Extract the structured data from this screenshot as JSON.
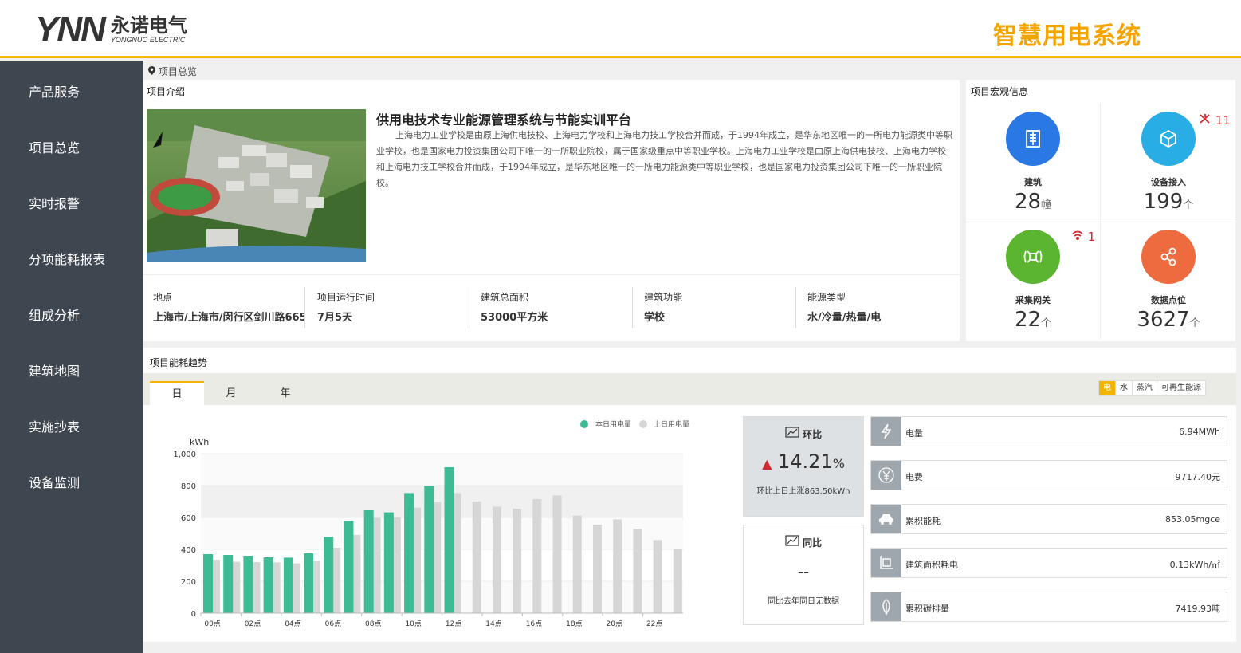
{
  "header": {
    "logo_mark": "YNN",
    "logo_cn": "永诺电气",
    "logo_en": "YONGNUO ELECTRIC",
    "system_title": "智慧用电系统"
  },
  "sidebar": {
    "items": [
      {
        "label": "产品服务"
      },
      {
        "label": "项目总览"
      },
      {
        "label": "实时报警"
      },
      {
        "label": "分项能耗报表"
      },
      {
        "label": "组成分析"
      },
      {
        "label": "建筑地图"
      },
      {
        "label": "实施抄表"
      },
      {
        "label": "设备监测"
      }
    ]
  },
  "breadcrumb": "项目总览",
  "intro": {
    "section_title": "项目介绍",
    "title": "供用电技术专业能源管理系统与节能实训平台",
    "description": "上海电力工业学校是由原上海供电技校、上海电力学校和上海电力技工学校合并而成，于1994年成立，是华东地区唯一的一所电力能源类中等职业学校，也是国家电力投资集团公司下唯一的一所职业院校，属于国家级重点中等职业学校。上海电力工业学校是由原上海供电技校、上海电力学校和上海电力技工学校合并而成，于1994年成立，是华东地区唯一的一所电力能源类中等职业学校，也是国家电力投资集团公司下唯一的一所职业院校。",
    "info": [
      {
        "label": "地点",
        "value": "上海市/上海市/闵行区剑川路665"
      },
      {
        "label": "项目运行时间",
        "value": "7月5天"
      },
      {
        "label": "建筑总面积",
        "value": "53000平方米"
      },
      {
        "label": "建筑功能",
        "value": "学校"
      },
      {
        "label": "能源类型",
        "value": "水/冷量/热量/电"
      }
    ]
  },
  "macro": {
    "section_title": "项目宏观信息",
    "items": [
      {
        "label": "建筑",
        "value": "28",
        "unit": "幢",
        "color": "#2a78e4",
        "icon": "building-icon"
      },
      {
        "label": "设备接入",
        "value": "199",
        "unit": "个",
        "color": "#28aee4",
        "icon": "cube-icon",
        "badge": "11",
        "badge_icon": "device-offline-icon"
      },
      {
        "label": "采集网关",
        "value": "22",
        "unit": "个",
        "color": "#5cb531",
        "icon": "gateway-icon",
        "badge": "1",
        "badge_icon": "wifi-alert-icon"
      },
      {
        "label": "数据点位",
        "value": "3627",
        "unit": "个",
        "color": "#ee6b3f",
        "icon": "share-nodes-icon"
      }
    ]
  },
  "trend": {
    "section_title": "项目能耗趋势",
    "tabs": [
      {
        "label": "日",
        "active": true
      },
      {
        "label": "月",
        "active": false
      },
      {
        "label": "年",
        "active": false
      }
    ],
    "energy_types": [
      {
        "label": "电",
        "active": true
      },
      {
        "label": "水",
        "active": false
      },
      {
        "label": "蒸汽",
        "active": false
      },
      {
        "label": "可再生能源",
        "active": false
      }
    ],
    "ring": {
      "title": "环比",
      "percent": "14.21",
      "percent_unit": "%",
      "note": "环比上日上涨863.50kWh"
    },
    "yoy": {
      "title": "同比",
      "value": "--",
      "note": "同比去年同日无数据"
    },
    "stats": [
      {
        "label": "电量",
        "value": "6.94MWh",
        "icon": "lightning-icon"
      },
      {
        "label": "电费",
        "value": "9717.40元",
        "icon": "yuan-coin-icon"
      },
      {
        "label": "累积能耗",
        "value": "853.05mgce",
        "icon": "energy-car-icon"
      },
      {
        "label": "建筑面积耗电",
        "value": "0.13kWh/㎡",
        "icon": "area-icon"
      },
      {
        "label": "累积碳排量",
        "value": "7419.93吨",
        "icon": "leaf-icon"
      }
    ]
  },
  "chart_data": {
    "type": "bar",
    "ylabel": "kWh",
    "ylim": [
      0,
      1000
    ],
    "yticks": [
      "0",
      "200",
      "400",
      "600",
      "800",
      "1,000"
    ],
    "categories": [
      "00点",
      "01点",
      "02点",
      "03点",
      "04点",
      "05点",
      "06点",
      "07点",
      "08点",
      "09点",
      "10点",
      "11点",
      "12点",
      "13点",
      "14点",
      "15点",
      "16点",
      "17点",
      "18点",
      "19点",
      "20点",
      "21点",
      "22点",
      "23点"
    ],
    "xtick_labels": [
      "00点",
      "02点",
      "04点",
      "06点",
      "08点",
      "10点",
      "12点",
      "14点",
      "16点",
      "18点",
      "20点",
      "22点"
    ],
    "legend_position": "top-right",
    "series": [
      {
        "name": "本日用电量",
        "color": "#3dbb95",
        "values": [
          370,
          365,
          360,
          350,
          348,
          375,
          478,
          578,
          645,
          632,
          753,
          798,
          915,
          null,
          null,
          null,
          null,
          null,
          null,
          null,
          null,
          null,
          null,
          null
        ]
      },
      {
        "name": "上日用电量",
        "color": "#d6d6d6",
        "values": [
          335,
          322,
          320,
          318,
          312,
          330,
          410,
          490,
          598,
          600,
          662,
          696,
          753,
          700,
          668,
          655,
          715,
          738,
          612,
          555,
          588,
          530,
          458,
          405
        ]
      }
    ]
  }
}
